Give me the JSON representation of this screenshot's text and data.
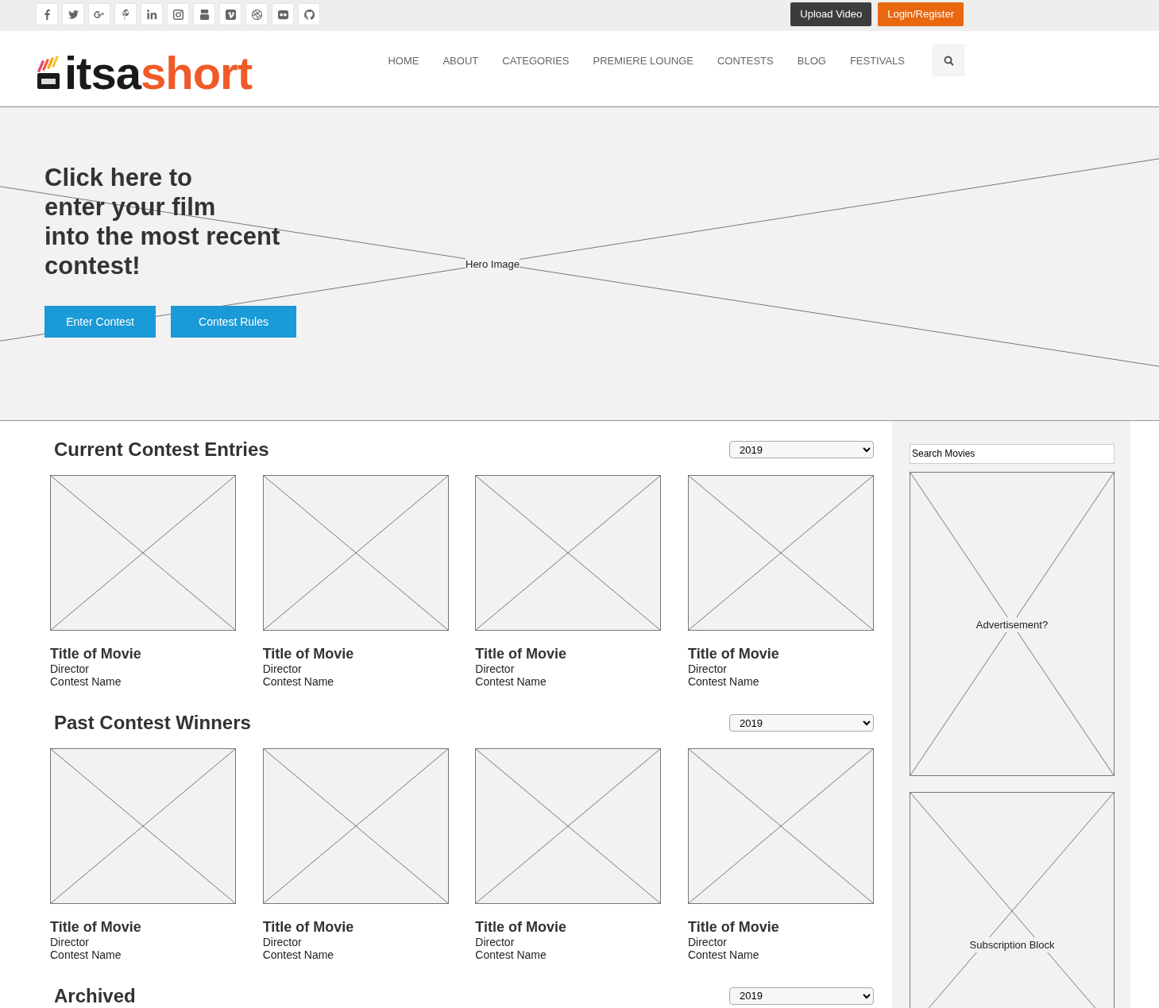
{
  "top_bar": {
    "social_links": [
      {
        "kind": "facebook"
      },
      {
        "kind": "twitter"
      },
      {
        "kind": "googleplus"
      },
      {
        "kind": "pinterest"
      },
      {
        "kind": "linkedin"
      },
      {
        "kind": "instagram"
      },
      {
        "kind": "youtube"
      },
      {
        "kind": "vimeo"
      },
      {
        "kind": "dribbble"
      },
      {
        "kind": "flickr"
      },
      {
        "kind": "github"
      }
    ],
    "buttons": [
      {
        "label": "Upload Video",
        "kind": "dark"
      },
      {
        "label": "Login/Register",
        "kind": "accent"
      }
    ]
  },
  "header": {
    "logo": {
      "dark_part": "itsa",
      "accent_part": "short"
    },
    "nav": [
      "HOME",
      "ABOUT",
      "CATEGORIES",
      "PREMIERE LOUNGE",
      "CONTESTS",
      "BLOG",
      "FESTIVALS"
    ]
  },
  "hero": {
    "headline": [
      "Click here to",
      "enter your film",
      "into the most recent",
      "contest!"
    ],
    "image_label": "Hero Image",
    "buttons": [
      "Enter Contest",
      "Contest  Rules"
    ]
  },
  "sections": [
    {
      "title": "Current Contest Entries",
      "year": "2019",
      "items": [
        {
          "title": "Title of Movie",
          "director": "Director",
          "contest": "Contest Name"
        },
        {
          "title": "Title of Movie",
          "director": "Director",
          "contest": "Contest Name"
        },
        {
          "title": "Title of Movie",
          "director": "Director",
          "contest": "Contest Name"
        },
        {
          "title": "Title of Movie",
          "director": "Director",
          "contest": "Contest Name"
        }
      ]
    },
    {
      "title": "Past Contest Winners",
      "year": "2019",
      "items": [
        {
          "title": "Title of Movie",
          "director": "Director",
          "contest": "Contest Name"
        },
        {
          "title": "Title of Movie",
          "director": "Director",
          "contest": "Contest Name"
        },
        {
          "title": "Title of Movie",
          "director": "Director",
          "contest": "Contest Name"
        },
        {
          "title": "Title of Movie",
          "director": "Director",
          "contest": "Contest Name"
        }
      ]
    },
    {
      "title": "Archived",
      "year": "2019"
    }
  ],
  "sidebar": {
    "search": {
      "placeholder": "Search Movies"
    },
    "blocks": [
      {
        "label": "Advertisement?"
      },
      {
        "label": "Subscription Block"
      }
    ]
  }
}
